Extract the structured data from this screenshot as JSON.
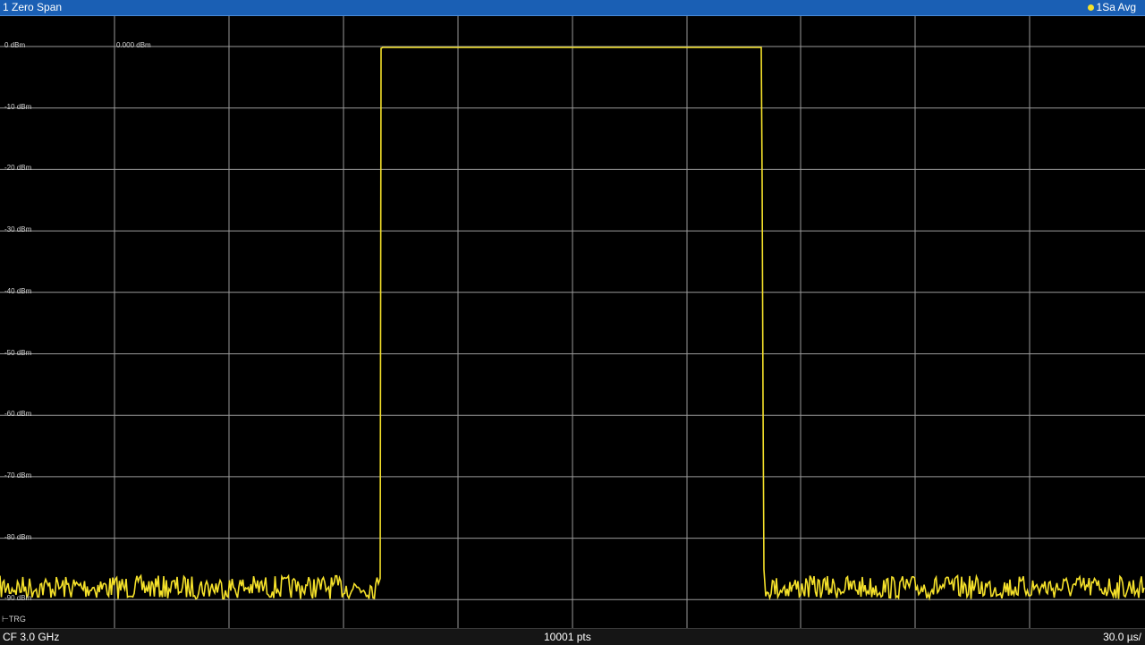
{
  "window": {
    "title": "1 Zero Span",
    "trace_info": "1Sa Avg"
  },
  "plot": {
    "ref_level_label": "0.000 dBm",
    "trigger_label": "TRG",
    "y_axis_labels": [
      "0 dBm",
      "-10 dBm",
      "-20 dBm",
      "-30 dBm",
      "-40 dBm",
      "-50 dBm",
      "-60 dBm",
      "-70 dBm",
      "-80 dBm",
      "-90 dBm"
    ]
  },
  "footer": {
    "center_frequency": "CF 3.0 GHz",
    "points": "10001 pts",
    "time_per_div": "30.0 µs/"
  },
  "colors": {
    "trace": "#f5e12a",
    "title_bar": "#1a5fb4",
    "grid": "#9a9a9a"
  }
}
